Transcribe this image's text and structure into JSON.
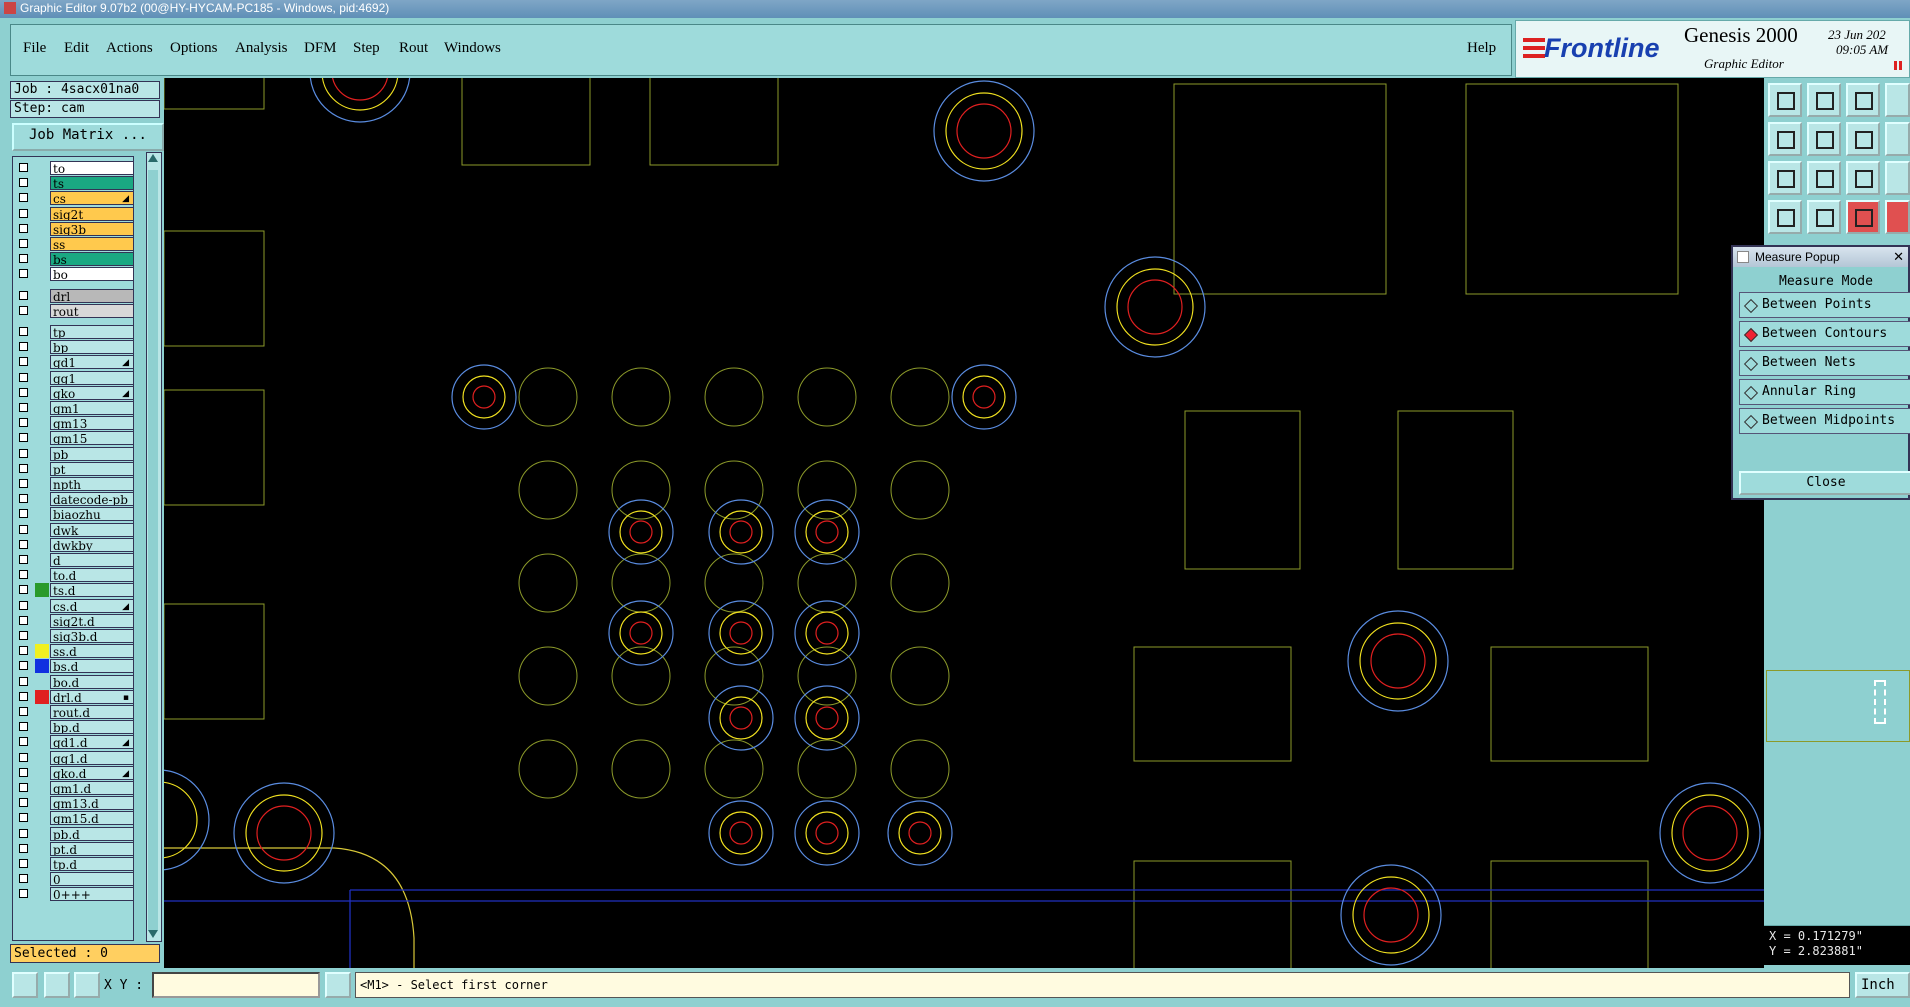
{
  "window": {
    "title": "Graphic Editor 9.07b2 (00@HY-HYCAM-PC185 - Windows, pid:4692)"
  },
  "menu": {
    "items": [
      "File",
      "Edit",
      "Actions",
      "Options",
      "Analysis",
      "DFM",
      "Step",
      "Rout",
      "Windows"
    ],
    "help": "Help"
  },
  "brand": {
    "logo": "Frontline",
    "product": "Genesis 2000",
    "subtitle": "Graphic Editor",
    "date": "23 Jun 202",
    "time": "09:05 AM"
  },
  "job": {
    "job_label": "Job : 4sacx01na0",
    "step_label": "Step: cam",
    "matrix_button": "Job Matrix ..."
  },
  "layers": [
    {
      "name": "to",
      "color": "#ffffff",
      "swatch": ""
    },
    {
      "name": "ts",
      "color": "#1aa882",
      "swatch": ""
    },
    {
      "name": "cs",
      "color": "#ffc94d",
      "swatch": "",
      "mark": "◢"
    },
    {
      "name": "sig2t",
      "color": "#ffc94d",
      "swatch": ""
    },
    {
      "name": "sig3b",
      "color": "#ffc94d",
      "swatch": ""
    },
    {
      "name": "ss",
      "color": "#ffc94d",
      "swatch": ""
    },
    {
      "name": "bs",
      "color": "#1aa882",
      "swatch": ""
    },
    {
      "name": "bo",
      "color": "#ffffff",
      "swatch": ""
    },
    {
      "name": "drl",
      "color": "#b8b8b8",
      "swatch": ""
    },
    {
      "name": "rout",
      "color": "#d8d8d8",
      "swatch": ""
    },
    {
      "name": "tp",
      "color": "#b9e6e6",
      "swatch": ""
    },
    {
      "name": "bp",
      "color": "#b9e6e6",
      "swatch": ""
    },
    {
      "name": "gd1",
      "color": "#b9e6e6",
      "swatch": "",
      "mark": "◢"
    },
    {
      "name": "gg1",
      "color": "#b9e6e6",
      "swatch": ""
    },
    {
      "name": "gko",
      "color": "#b9e6e6",
      "swatch": "",
      "mark": "◢"
    },
    {
      "name": "gm1",
      "color": "#b9e6e6",
      "swatch": ""
    },
    {
      "name": "gm13",
      "color": "#b9e6e6",
      "swatch": ""
    },
    {
      "name": "gm15",
      "color": "#b9e6e6",
      "swatch": ""
    },
    {
      "name": "pb",
      "color": "#b9e6e6",
      "swatch": ""
    },
    {
      "name": "pt",
      "color": "#b9e6e6",
      "swatch": ""
    },
    {
      "name": "npth",
      "color": "#b9e6e6",
      "swatch": ""
    },
    {
      "name": "datecode-pb",
      "color": "#b9e6e6",
      "swatch": ""
    },
    {
      "name": "biaozhu",
      "color": "#b9e6e6",
      "swatch": ""
    },
    {
      "name": "dwk",
      "color": "#b9e6e6",
      "swatch": ""
    },
    {
      "name": "dwkby",
      "color": "#b9e6e6",
      "swatch": ""
    },
    {
      "name": "d",
      "color": "#b9e6e6",
      "swatch": ""
    },
    {
      "name": "to.d",
      "color": "#b9e6e6",
      "swatch": ""
    },
    {
      "name": "ts.d",
      "color": "#b9e6e6",
      "swatch": "#2a9a2a"
    },
    {
      "name": "cs.d",
      "color": "#b9e6e6",
      "swatch": "",
      "mark": "◢"
    },
    {
      "name": "sig2t.d",
      "color": "#b9e6e6",
      "swatch": ""
    },
    {
      "name": "sig3b.d",
      "color": "#b9e6e6",
      "swatch": ""
    },
    {
      "name": "ss.d",
      "color": "#b9e6e6",
      "swatch": "#f0f020"
    },
    {
      "name": "bs.d",
      "color": "#b9e6e6",
      "swatch": "#1030e0"
    },
    {
      "name": "bo.d",
      "color": "#b9e6e6",
      "swatch": ""
    },
    {
      "name": "drl.d",
      "color": "#b9e6e6",
      "swatch": "#e02020",
      "mark": "▪"
    },
    {
      "name": "rout.d",
      "color": "#b9e6e6",
      "swatch": ""
    },
    {
      "name": "bp.d",
      "color": "#b9e6e6",
      "swatch": ""
    },
    {
      "name": "gd1.d",
      "color": "#b9e6e6",
      "swatch": "",
      "mark": "◢"
    },
    {
      "name": "gg1.d",
      "color": "#b9e6e6",
      "swatch": ""
    },
    {
      "name": "gko.d",
      "color": "#b9e6e6",
      "swatch": "",
      "mark": "◢"
    },
    {
      "name": "gm1.d",
      "color": "#b9e6e6",
      "swatch": ""
    },
    {
      "name": "gm13.d",
      "color": "#b9e6e6",
      "swatch": ""
    },
    {
      "name": "gm15.d",
      "color": "#b9e6e6",
      "swatch": ""
    },
    {
      "name": "pb.d",
      "color": "#b9e6e6",
      "swatch": ""
    },
    {
      "name": "pt.d",
      "color": "#b9e6e6",
      "swatch": ""
    },
    {
      "name": "tp.d",
      "color": "#b9e6e6",
      "swatch": ""
    },
    {
      "name": "0",
      "color": "#b9e6e6",
      "swatch": ""
    },
    {
      "name": "0+++",
      "color": "#b9e6e6",
      "swatch": ""
    }
  ],
  "selected": "Selected : 0",
  "measure_popup": {
    "title": "Measure Popup",
    "mode_label": "Measure Mode",
    "options": [
      "Between Points",
      "Between Contours",
      "Between Nets",
      "Annular Ring",
      "Between Midpoints"
    ],
    "selected_option": "Between Contours",
    "close_label": "Close"
  },
  "coords": {
    "x": "X = 0.171279\"",
    "y": "Y = 2.823881\""
  },
  "bottom": {
    "xy_label": "X Y :",
    "xy_value": "",
    "status": "<M1> - Select first corner",
    "units": "Inch"
  },
  "colors": {
    "panel": "#8ed0d0",
    "canvas": "#000000",
    "outline": "#8c9a2a",
    "pad_red": "#e02020",
    "pad_yellow": "#f0e020",
    "pad_blue": "#5a8ce0"
  }
}
